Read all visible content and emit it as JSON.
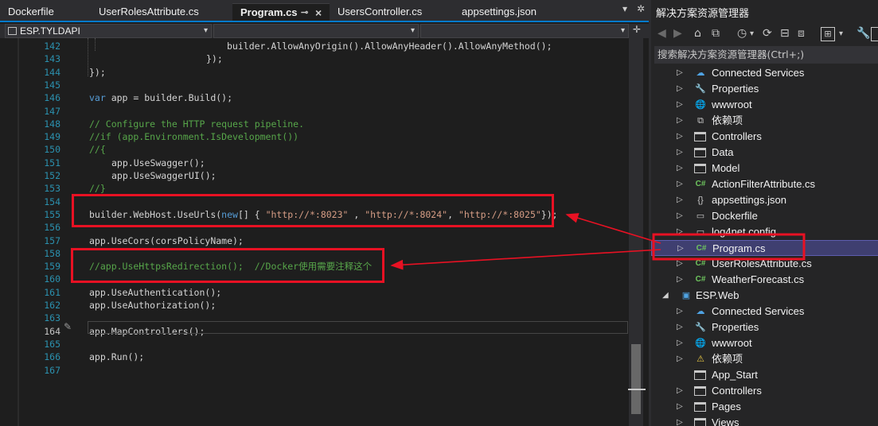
{
  "tabs": [
    {
      "label": "Dockerfile",
      "active": false
    },
    {
      "label": "UserRolesAttribute.cs",
      "active": false
    },
    {
      "label": "Program.cs",
      "active": true
    },
    {
      "label": "UsersController.cs",
      "active": false
    },
    {
      "label": "appsettings.json",
      "active": false
    }
  ],
  "navbar": {
    "project": "ESP.TYLDAPI"
  },
  "code_lines": [
    {
      "n": "142"
    },
    {
      "n": "143"
    },
    {
      "n": "144"
    },
    {
      "n": "145"
    },
    {
      "n": "146"
    },
    {
      "n": "147"
    },
    {
      "n": "148"
    },
    {
      "n": "149"
    },
    {
      "n": "150"
    },
    {
      "n": "151"
    },
    {
      "n": "152"
    },
    {
      "n": "153"
    },
    {
      "n": "154"
    },
    {
      "n": "155"
    },
    {
      "n": "156"
    },
    {
      "n": "157"
    },
    {
      "n": "158"
    },
    {
      "n": "159"
    },
    {
      "n": "160"
    },
    {
      "n": "161"
    },
    {
      "n": "162"
    },
    {
      "n": "163"
    },
    {
      "n": "164"
    },
    {
      "n": "165"
    },
    {
      "n": "166"
    },
    {
      "n": "167"
    }
  ],
  "code": {
    "l142": "builder.AllowAnyOrigin().AllowAnyHeader().AllowAnyMethod();",
    "l143": "});",
    "l144": "});",
    "l146_kw": "var",
    "l146": " app = builder.Build();",
    "l148": "// Configure the HTTP request pipeline.",
    "l149": "//if (app.Environment.IsDevelopment())",
    "l150": "//{",
    "l151": "app.UseSwagger();",
    "l152": "app.UseSwaggerUI();",
    "l153": "//}",
    "l155_a": "builder.WebHost.UseUrls(",
    "l155_kw": "new",
    "l155_b": "[] { ",
    "l155_s1": "\"http://*:8023\"",
    "l155_c": " , ",
    "l155_s2": "\"http://*:8024\"",
    "l155_d": ", ",
    "l155_s3": "\"http://*:8025\"",
    "l155_e": "});",
    "l157": "app.UseCors(corsPolicyName);",
    "l159": "//app.UseHttpsRedirection();  //Docker使用需要注释这个",
    "l161": "app.UseAuthentication();",
    "l162": "app.UseAuthorization();",
    "l164": "app.MapControllers();",
    "l166": "app.Run();"
  },
  "solution_explorer": {
    "title": "解决方案资源管理器",
    "search_placeholder": "搜索解决方案资源管理器(Ctrl+;)",
    "items": [
      {
        "label": "Connected Services",
        "icon": "connected-services-icon"
      },
      {
        "label": "Properties",
        "icon": "properties-icon"
      },
      {
        "label": "wwwroot",
        "icon": "globe-icon"
      },
      {
        "label": "依赖项",
        "icon": "dependencies-icon"
      },
      {
        "label": "Controllers",
        "icon": "folder-icon"
      },
      {
        "label": "Data",
        "icon": "folder-icon"
      },
      {
        "label": "Model",
        "icon": "folder-icon"
      },
      {
        "label": "ActionFilterAttribute.cs",
        "icon": "csharp-file-icon"
      },
      {
        "label": "appsettings.json",
        "icon": "json-file-icon"
      },
      {
        "label": "Dockerfile",
        "icon": "file-icon"
      },
      {
        "label": "log4net.config",
        "icon": "config-file-icon"
      },
      {
        "label": "Program.cs",
        "icon": "csharp-file-icon",
        "selected": true
      },
      {
        "label": "UserRolesAttribute.cs",
        "icon": "csharp-file-icon"
      },
      {
        "label": "WeatherForecast.cs",
        "icon": "csharp-file-icon"
      },
      {
        "label": "ESP.Web",
        "icon": "web-project-icon"
      },
      {
        "label": "Connected Services",
        "icon": "connected-services-icon"
      },
      {
        "label": "Properties",
        "icon": "properties-icon"
      },
      {
        "label": "wwwroot",
        "icon": "globe-icon"
      },
      {
        "label": "依赖项",
        "icon": "dependencies-warning-icon"
      },
      {
        "label": "App_Start",
        "icon": "folder-icon"
      },
      {
        "label": "Controllers",
        "icon": "folder-icon"
      },
      {
        "label": "Pages",
        "icon": "folder-icon"
      },
      {
        "label": "Views",
        "icon": "folder-icon"
      }
    ]
  },
  "colors": {
    "accent": "#007acc",
    "annotation_red": "#e81123",
    "selection": "#3f3f70"
  }
}
